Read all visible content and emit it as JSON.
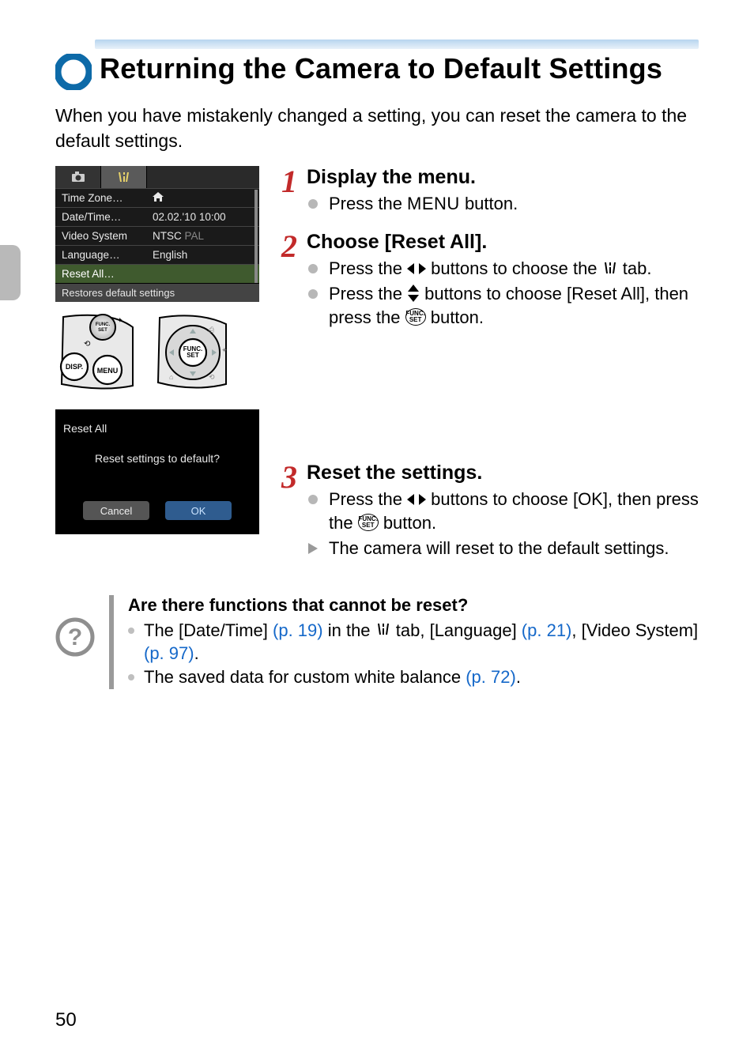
{
  "page_number": "50",
  "page_title": "Returning the Camera to Default Settings",
  "intro": "When you have mistakenly changed a setting, you can reset the camera to the default settings.",
  "lcd_menu": {
    "rows": [
      {
        "label": "Time Zone…",
        "value_icon": "home"
      },
      {
        "label": "Date/Time…",
        "value": "02.02.'10 10:00"
      },
      {
        "label": "Video System",
        "value": "NTSC",
        "value_dim": "PAL"
      },
      {
        "label": "Language…",
        "value": "English"
      },
      {
        "label": "Reset All…",
        "value": "",
        "selected": true
      }
    ],
    "footer": "Restores default settings"
  },
  "reset_dialog": {
    "title": "Reset All",
    "question": "Reset settings to default?",
    "cancel": "Cancel",
    "ok": "OK"
  },
  "steps": [
    {
      "num": "1",
      "title": "Display the menu.",
      "items": [
        {
          "type": "dot",
          "pre": "Press the ",
          "menu_word": "MENU",
          "post": " button."
        }
      ]
    },
    {
      "num": "2",
      "title": "Choose [Reset All].",
      "items": [
        {
          "type": "dot",
          "pre": "Press the ",
          "nav_lr": true,
          "mid": " buttons to choose the ",
          "wrench": true,
          "post": " tab."
        },
        {
          "type": "dot",
          "pre": "Press the ",
          "nav_ud": true,
          "mid": " buttons to choose [Reset All], then press the ",
          "fset": true,
          "post": " button."
        }
      ]
    },
    {
      "num": "3",
      "title": "Reset the settings.",
      "items": [
        {
          "type": "dot",
          "pre": "Press the ",
          "nav_lr": true,
          "mid": " buttons to choose [OK], then press the ",
          "fset": true,
          "post": " button."
        },
        {
          "type": "tri",
          "pre": "The camera will reset to the default settings."
        }
      ]
    }
  ],
  "note": {
    "title": "Are there functions that cannot be reset?",
    "items": [
      {
        "parts": [
          {
            "t": "The [Date/Time] "
          },
          {
            "t": "(p. 19)",
            "link": true
          },
          {
            "t": " in the "
          },
          {
            "wrench": true
          },
          {
            "t": " tab, [Language] "
          },
          {
            "t": "(p. 21)",
            "link": true
          },
          {
            "t": ", [Video System] "
          },
          {
            "t": "(p. 97)",
            "link": true
          },
          {
            "t": "."
          }
        ]
      },
      {
        "parts": [
          {
            "t": "The saved data for custom white balance "
          },
          {
            "t": "(p. 72)",
            "link": true
          },
          {
            "t": "."
          }
        ]
      }
    ]
  }
}
